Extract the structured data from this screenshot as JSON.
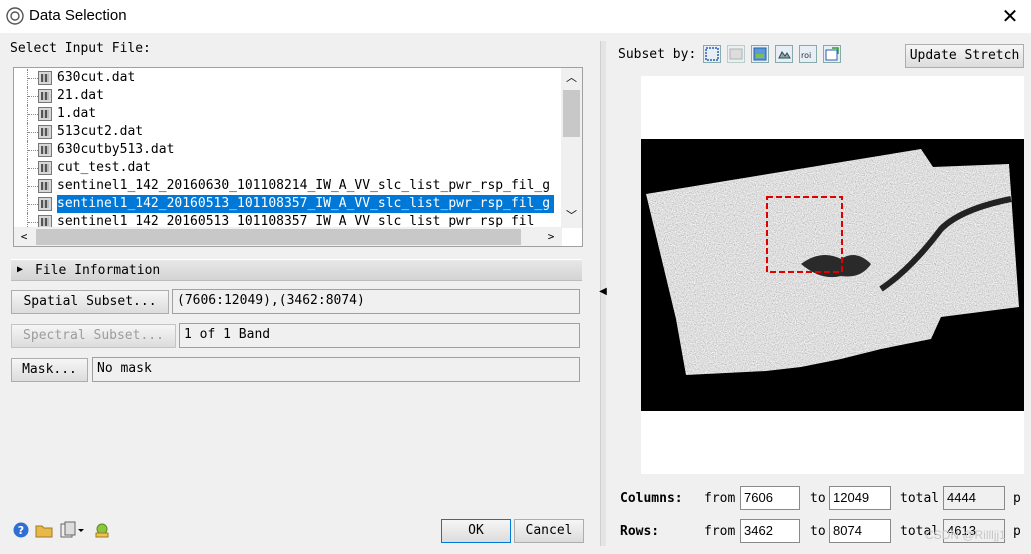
{
  "window": {
    "title": "Data Selection",
    "close_glyph": "✕"
  },
  "input": {
    "label": "Select Input File:",
    "files": [
      {
        "name": "630cut.dat"
      },
      {
        "name": "21.dat"
      },
      {
        "name": "1.dat"
      },
      {
        "name": "513cut2.dat"
      },
      {
        "name": "630cutby513.dat"
      },
      {
        "name": "cut_test.dat"
      },
      {
        "name": "sentinel1_142_20160630_101108214_IW_A_VV_slc_list_pwr_rsp_fil_g"
      },
      {
        "name": "sentinel1_142_20160513_101108357_IW_A_VV_slc_list_pwr_rsp_fil_g"
      },
      {
        "name": "sentinel1_142_20160513_101108357_IW_A_VV_slc_list_pwr_rsp_fil"
      }
    ],
    "selected_index": 7
  },
  "file_information": {
    "label": "File Information"
  },
  "subsets": {
    "spatial_button": "Spatial Subset...",
    "spatial_value": "(7606:12049),(3462:8074)",
    "spectral_button": "Spectral Subset...",
    "spectral_value": "1 of 1 Band",
    "mask_button": "Mask...",
    "mask_value": "No mask"
  },
  "buttons": {
    "ok": "OK",
    "cancel": "Cancel"
  },
  "bottom_icons": [
    "help-icon",
    "open-folder-icon",
    "file-options-icon",
    "network-icon"
  ],
  "right": {
    "subset_by_label": "Subset by:",
    "subset_icons": [
      "image-icon",
      "map-icon",
      "file-icon",
      "roi-icon",
      "vector-icon",
      "previous-icon"
    ],
    "update_stretch": "Update Stretch"
  },
  "dimensions": {
    "columns_label": "Columns:",
    "rows_label": "Rows:",
    "from_label": "from",
    "to_label": "to",
    "total_label": "total",
    "columns": {
      "from": "7606",
      "to": "12049",
      "total": "4444"
    },
    "rows": {
      "from": "3462",
      "to": "8074",
      "total": "4613"
    },
    "trailing": "p"
  },
  "watermark": "CSDN @Rillljj1"
}
